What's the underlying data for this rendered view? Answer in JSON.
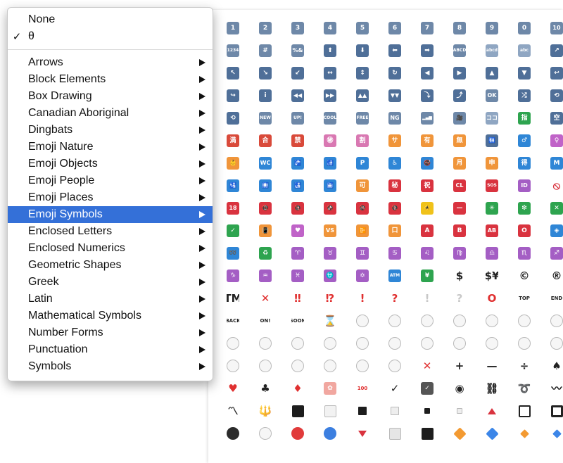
{
  "menu": {
    "none_label": "None",
    "theta_check": "✓",
    "theta_label": "θ",
    "items": [
      {
        "label": "Arrows"
      },
      {
        "label": "Block Elements"
      },
      {
        "label": "Box Drawing"
      },
      {
        "label": "Canadian Aboriginal"
      },
      {
        "label": "Dingbats"
      },
      {
        "label": "Emoji Nature"
      },
      {
        "label": "Emoji Objects"
      },
      {
        "label": "Emoji People"
      },
      {
        "label": "Emoji Places"
      },
      {
        "label": "Emoji Symbols",
        "selected": true
      },
      {
        "label": "Enclosed Letters"
      },
      {
        "label": "Enclosed Numerics"
      },
      {
        "label": "Geometric Shapes"
      },
      {
        "label": "Greek"
      },
      {
        "label": "Latin"
      },
      {
        "label": "Mathematical Symbols"
      },
      {
        "label": "Number Forms"
      },
      {
        "label": "Punctuation"
      },
      {
        "label": "Symbols"
      }
    ]
  },
  "grid": {
    "rows": [
      [
        [
          "keycap-1-icon",
          "1",
          "#6e88a8"
        ],
        [
          "keycap-2-icon",
          "2",
          "#6e88a8"
        ],
        [
          "keycap-3-icon",
          "3",
          "#6e88a8"
        ],
        [
          "keycap-4-icon",
          "4",
          "#6e88a8"
        ],
        [
          "keycap-5-icon",
          "5",
          "#6e88a8"
        ],
        [
          "keycap-6-icon",
          "6",
          "#6e88a8"
        ],
        [
          "keycap-7-icon",
          "7",
          "#6e88a8"
        ],
        [
          "keycap-8-icon",
          "8",
          "#6e88a8"
        ],
        [
          "keycap-9-icon",
          "9",
          "#6e88a8"
        ],
        [
          "keycap-0-icon",
          "0",
          "#6e88a8"
        ],
        [
          "keycap-10-icon",
          "10",
          "#6e88a8"
        ]
      ],
      [
        [
          "input-numbers-icon",
          "1234",
          "#6e88a8"
        ],
        [
          "hash-key-icon",
          "#",
          "#6e88a8"
        ],
        [
          "input-symbols-icon",
          "%&",
          "#6e88a8"
        ],
        [
          "arrow-up-icon",
          "⬆",
          "#4f6f98"
        ],
        [
          "arrow-down-icon",
          "⬇",
          "#4f6f98"
        ],
        [
          "arrow-left-icon",
          "⬅",
          "#4f6f98"
        ],
        [
          "arrow-right-icon",
          "➡",
          "#4f6f98"
        ],
        [
          "input-latin-upper-icon",
          "ABCD",
          "#6e88a8"
        ],
        [
          "input-latin-lower-icon",
          "abcd",
          "#8fa6c2"
        ],
        [
          "input-latin-letters-icon",
          "abc",
          "#8fa6c2"
        ],
        [
          "arrow-upper-right-icon",
          "↗",
          "#4f6f98"
        ]
      ],
      [
        [
          "arrow-upper-left-icon",
          "↖",
          "#4f6f98"
        ],
        [
          "arrow-lower-right-icon",
          "↘",
          "#4f6f98"
        ],
        [
          "arrow-lower-left-icon",
          "↙",
          "#4f6f98"
        ],
        [
          "left-right-arrow-icon",
          "↔",
          "#4f6f98"
        ],
        [
          "up-down-arrow-icon",
          "↕",
          "#4f6f98"
        ],
        [
          "refresh-arrows-icon",
          "↻",
          "#4f6f98"
        ],
        [
          "arrow-backward-icon",
          "◀",
          "#4f6f98"
        ],
        [
          "arrow-forward-icon",
          "▶",
          "#4f6f98"
        ],
        [
          "arrow-up-small-icon",
          "▲",
          "#4f6f98"
        ],
        [
          "arrow-down-small-icon",
          "▼",
          "#4f6f98"
        ],
        [
          "return-arrow-right-icon",
          "↩",
          "#4f6f98"
        ]
      ],
      [
        [
          "return-arrow-left-icon",
          "↪",
          "#4f6f98"
        ],
        [
          "information-icon",
          "i",
          "#4f6f98"
        ],
        [
          "rewind-icon",
          "◀◀",
          "#4f6f98"
        ],
        [
          "fast-forward-icon",
          "▶▶",
          "#4f6f98"
        ],
        [
          "fast-up-icon",
          "▲▲",
          "#4f6f98"
        ],
        [
          "fast-down-icon",
          "▼▼",
          "#4f6f98"
        ],
        [
          "arrow-heading-down-icon",
          "⤵",
          "#4f6f98"
        ],
        [
          "arrow-heading-up-icon",
          "⤴",
          "#4f6f98"
        ],
        [
          "ok-button-icon",
          "OK",
          "#6e88a8"
        ],
        [
          "shuffle-icon",
          "⤮",
          "#4f6f98"
        ],
        [
          "repeat-icon",
          "⟲",
          "#4f6f98"
        ]
      ],
      [
        [
          "repeat-one-icon",
          "⟲",
          "#4f6f98"
        ],
        [
          "new-button-icon",
          "NEW",
          "#6e88a8"
        ],
        [
          "up-button-icon",
          "UP!",
          "#6e88a8"
        ],
        [
          "cool-button-icon",
          "COOL",
          "#6e88a8"
        ],
        [
          "free-button-icon",
          "FREE",
          "#6e88a8"
        ],
        [
          "ng-button-icon",
          "NG",
          "#6e88a8"
        ],
        [
          "signal-strength-icon",
          "▂▄▆",
          "#6e88a8"
        ],
        [
          "cinema-icon",
          "🎥",
          "#6e88a8"
        ],
        [
          "koko-button-icon",
          "ココ",
          "#8fa6c2"
        ],
        [
          "finger-button-icon",
          "指",
          "#2ea44f"
        ],
        [
          "vacancy-button-icon",
          "空",
          "#4f6f98"
        ]
      ],
      [
        [
          "full-button-icon",
          "満",
          "#d94a3a"
        ],
        [
          "passing-grade-button-icon",
          "合",
          "#d94a3a"
        ],
        [
          "prohibited-button-icon",
          "禁",
          "#d94a3a"
        ],
        [
          "secret-circle-icon",
          "㊙",
          "#d978b2"
        ],
        [
          "discount-button-icon",
          "割",
          "#d978b2"
        ],
        [
          "service-charge-button-icon",
          "サ",
          "#f0953a"
        ],
        [
          "not-free-button-icon",
          "有",
          "#f0953a"
        ],
        [
          "free-of-charge-button-icon",
          "無",
          "#f0953a"
        ],
        [
          "restroom-icon",
          "🚻",
          "#4f6f98"
        ],
        [
          "mens-room-icon",
          "♂",
          "#2f86d6"
        ],
        [
          "womens-room-icon",
          "♀",
          "#c063c8"
        ]
      ],
      [
        [
          "baby-symbol-icon",
          "👶",
          "#f0953a"
        ],
        [
          "water-closet-icon",
          "WC",
          "#2f86d6"
        ],
        [
          "potable-water-icon",
          "🚰",
          "#2f86d6"
        ],
        [
          "put-litter-icon",
          "🚮",
          "#2f86d6"
        ],
        [
          "parking-icon",
          "P",
          "#2f86d6"
        ],
        [
          "wheelchair-icon",
          "♿",
          "#2f86d6"
        ],
        [
          "no-smoking-icon",
          "🚭",
          "#2f86d6"
        ],
        [
          "monthly-amount-button-icon",
          "月",
          "#f0953a"
        ],
        [
          "application-button-icon",
          "申",
          "#f0953a"
        ],
        [
          "bargain-button-icon",
          "得",
          "#2f86d6"
        ],
        [
          "metro-icon",
          "M",
          "#2f86d6"
        ]
      ],
      [
        [
          "passport-control-icon",
          "🛂",
          "#2f86d6"
        ],
        [
          "baggage-claim-icon",
          "🛄",
          "#2f86d6"
        ],
        [
          "customs-icon",
          "🛃",
          "#2f86d6"
        ],
        [
          "left-luggage-icon",
          "🛅",
          "#2f86d6"
        ],
        [
          "accept-button-icon",
          "可",
          "#f0953a"
        ],
        [
          "secret-button-icon",
          "秘",
          "#d9333f"
        ],
        [
          "congratulations-button-icon",
          "祝",
          "#d9333f"
        ],
        [
          "cl-button-icon",
          "CL",
          "#d9333f"
        ],
        [
          "sos-button-icon",
          "SOS",
          "#d9333f"
        ],
        [
          "id-button-icon",
          "ID",
          "#a45ec4"
        ],
        [
          "no-entry-sign-icon",
          "⦸",
          "#ffffff"
        ]
      ],
      [
        [
          "no-one-under-18-icon",
          "18",
          "#d9333f"
        ],
        [
          "no-mobile-phones-icon",
          "📵",
          "#d9333f"
        ],
        [
          "do-not-litter-icon",
          "🚯",
          "#d9333f"
        ],
        [
          "non-potable-water-icon",
          "🚱",
          "#d9333f"
        ],
        [
          "no-bicycles-icon",
          "🚳",
          "#d9333f"
        ],
        [
          "no-pedestrians-icon",
          "🚷",
          "#d9333f"
        ],
        [
          "children-crossing-icon",
          "🚸",
          "#f0c21a"
        ],
        [
          "no-entry-icon",
          "—",
          "#d9333f"
        ],
        [
          "eight-spoked-asterisk-icon",
          "✳",
          "#2ea44f"
        ],
        [
          "sparkle-icon",
          "❇",
          "#2ea44f"
        ],
        [
          "negative-cross-mark-icon",
          "✕",
          "#2ea44f"
        ]
      ],
      [
        [
          "white-check-mark-icon",
          "✓",
          "#2ea44f"
        ],
        [
          "vibration-mode-icon",
          "📳",
          "#f0953a"
        ],
        [
          "heart-decoration-icon",
          "♥",
          "#c063c8"
        ],
        [
          "vs-button-icon",
          "VS",
          "#f0953a"
        ],
        [
          "mobile-phone-off-icon",
          "📴",
          "#f0953a"
        ],
        [
          "japanese-symbol-icon",
          "口",
          "#f0953a"
        ],
        [
          "a-button-icon",
          "A",
          "#d9333f"
        ],
        [
          "b-button-icon",
          "B",
          "#d9333f"
        ],
        [
          "ab-button-icon",
          "AB",
          "#d9333f"
        ],
        [
          "o-button-icon",
          "O",
          "#d9333f"
        ],
        [
          "diamond-with-dot-icon",
          "◈",
          "#2f86d6"
        ]
      ],
      [
        [
          "loop-icon",
          "➿",
          "#2f86d6"
        ],
        [
          "recycle-icon",
          "♻",
          "#2ea44f"
        ],
        [
          "aries-icon",
          "♈",
          "#a45ec4"
        ],
        [
          "taurus-icon",
          "♉",
          "#a45ec4"
        ],
        [
          "gemini-icon",
          "♊",
          "#a45ec4"
        ],
        [
          "cancer-icon",
          "♋",
          "#a45ec4"
        ],
        [
          "leo-icon",
          "♌",
          "#a45ec4"
        ],
        [
          "virgo-icon",
          "♍",
          "#a45ec4"
        ],
        [
          "libra-icon",
          "♎",
          "#a45ec4"
        ],
        [
          "scorpius-icon",
          "♏",
          "#a45ec4"
        ],
        [
          "sagittarius-icon",
          "♐",
          "#a45ec4"
        ]
      ],
      [
        [
          "capricorn-icon",
          "♑",
          "#a45ec4"
        ],
        [
          "aquarius-icon",
          "♒",
          "#a45ec4"
        ],
        [
          "pisces-icon",
          "♓",
          "#a45ec4"
        ],
        [
          "ophiuchus-icon",
          "⛎",
          "#a45ec4"
        ],
        [
          "six-pointed-star-icon",
          "✡",
          "#a45ec4"
        ],
        [
          "atm-icon",
          "ATM",
          "#2f86d6"
        ],
        [
          "chart-icon",
          "¥",
          "#2ea44f"
        ],
        [
          "heavy-dollar-sign-icon",
          "$",
          "transparent"
        ],
        [
          "currency-exchange-icon",
          "$¥",
          "transparent"
        ],
        [
          "copyright-icon",
          "©",
          "transparent"
        ],
        [
          "registered-icon",
          "®",
          "transparent"
        ]
      ],
      [
        [
          "trade-mark-icon",
          "TM",
          "transparent"
        ],
        [
          "cross-mark-icon",
          "✕",
          "transparent"
        ],
        [
          "double-exclamation-icon",
          "‼",
          "transparent"
        ],
        [
          "interrobang-icon",
          "⁉",
          "transparent"
        ],
        [
          "exclamation-icon",
          "!",
          "transparent"
        ],
        [
          "question-icon",
          "?",
          "transparent"
        ],
        [
          "grey-exclamation-icon",
          "!",
          "transparent"
        ],
        [
          "grey-question-icon",
          "?",
          "transparent"
        ],
        [
          "heavy-circle-icon",
          "O",
          "transparent"
        ],
        [
          "top-arrow-icon",
          "TOP",
          "transparent"
        ],
        [
          "end-arrow-icon",
          "END",
          "transparent"
        ]
      ],
      [
        [
          "back-arrow-icon",
          "BACK",
          "transparent"
        ],
        [
          "on-arrow-icon",
          "ON!",
          "transparent"
        ],
        [
          "soon-arrow-icon",
          "SOON",
          "transparent"
        ],
        [
          "hourglass-icon",
          "⌛",
          "transparent"
        ],
        [
          "clock-1-icon",
          "",
          "clock"
        ],
        [
          "clock-2-icon",
          "",
          "clock"
        ],
        [
          "clock-3-icon",
          "",
          "clock"
        ],
        [
          "clock-4-icon",
          "",
          "clock"
        ],
        [
          "clock-5-icon",
          "",
          "clock"
        ],
        [
          "clock-6-icon",
          "",
          "clock"
        ],
        [
          "clock-7-icon",
          "",
          "clock"
        ]
      ],
      [
        [
          "clock-8-icon",
          "",
          "clock"
        ],
        [
          "clock-9-icon",
          "",
          "clock"
        ],
        [
          "clock-10-icon",
          "",
          "clock"
        ],
        [
          "clock-11-icon",
          "",
          "clock"
        ],
        [
          "clock-12-icon",
          "",
          "clock"
        ],
        [
          "clock-130-icon",
          "",
          "clock"
        ],
        [
          "clock-230-icon",
          "",
          "clock"
        ],
        [
          "clock-330-icon",
          "",
          "clock"
        ],
        [
          "clock-430-icon",
          "",
          "clock"
        ],
        [
          "clock-530-icon",
          "",
          "clock"
        ],
        [
          "clock-630-icon",
          "",
          "clock"
        ]
      ],
      [
        [
          "clock-730-icon",
          "",
          "clock"
        ],
        [
          "clock-830-icon",
          "",
          "clock"
        ],
        [
          "clock-930-icon",
          "",
          "clock"
        ],
        [
          "clock-1030-icon",
          "",
          "clock"
        ],
        [
          "clock-1130-icon",
          "",
          "clock"
        ],
        [
          "clock-1230-icon",
          "",
          "clock"
        ],
        [
          "heavy-multiplication-icon",
          "✕",
          "transparent"
        ],
        [
          "heavy-plus-icon",
          "+",
          "transparent"
        ],
        [
          "heavy-minus-icon",
          "—",
          "transparent"
        ],
        [
          "heavy-division-icon",
          "÷",
          "transparent"
        ],
        [
          "spade-suit-icon",
          "♠",
          "transparent"
        ]
      ],
      [
        [
          "heart-suit-icon",
          "♥",
          "transparent"
        ],
        [
          "club-suit-icon",
          "♣",
          "transparent"
        ],
        [
          "diamond-suit-icon",
          "♦",
          "transparent"
        ],
        [
          "white-flower-icon",
          "✿",
          "#f1a7a0"
        ],
        [
          "hundred-points-icon",
          "100",
          "transparent"
        ],
        [
          "heavy-check-mark-icon",
          "✓",
          "transparent"
        ],
        [
          "ballot-box-check-icon",
          "✓",
          "#555555"
        ],
        [
          "radio-button-icon",
          "◉",
          "transparent"
        ],
        [
          "link-icon",
          "⛓",
          "transparent"
        ],
        [
          "curly-loop-icon",
          "➰",
          "transparent"
        ],
        [
          "wavy-dash-icon",
          "〰",
          "transparent"
        ]
      ],
      [
        [
          "part-alternation-mark-icon",
          "〽",
          "transparent"
        ],
        [
          "trident-emblem-icon",
          "🔱",
          "transparent"
        ],
        [
          "black-medium-square-icon",
          "",
          "sq-lg-black"
        ],
        [
          "white-medium-square-icon",
          "",
          "sq-lg-white"
        ],
        [
          "black-medium-small-square-icon",
          "",
          "sq-md-black"
        ],
        [
          "white-medium-small-square-icon",
          "",
          "sq-md-white"
        ],
        [
          "black-small-square-icon",
          "",
          "sq-sm-black"
        ],
        [
          "white-small-square-icon",
          "",
          "sq-sm-white"
        ],
        [
          "red-triangle-up-icon",
          "",
          "tri-up"
        ],
        [
          "black-square-button-icon",
          "",
          "outline"
        ],
        [
          "white-square-button-icon",
          "",
          "outline-dark"
        ]
      ],
      [
        [
          "black-circle-icon",
          "",
          "circle-black"
        ],
        [
          "white-circle-icon",
          "",
          "circle-white"
        ],
        [
          "red-circle-icon",
          "",
          "circle-red"
        ],
        [
          "blue-circle-icon",
          "",
          "circle-blue"
        ],
        [
          "red-triangle-down-icon",
          "",
          "tri"
        ],
        [
          "white-large-square-icon",
          "",
          "sq-lg-light"
        ],
        [
          "black-large-square-icon",
          "",
          "sq-lg-black"
        ],
        [
          "large-orange-diamond-icon",
          "",
          "diam-orange"
        ],
        [
          "large-blue-diamond-icon",
          "",
          "diam-blue"
        ],
        [
          "small-orange-diamond-icon",
          "",
          "diam-sm-orange"
        ],
        [
          "small-blue-diamond-icon",
          "",
          "diam-sm-blue"
        ]
      ]
    ]
  }
}
